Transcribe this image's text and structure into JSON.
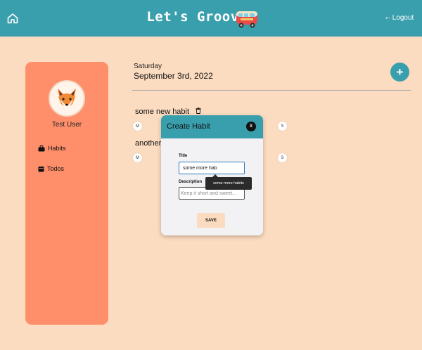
{
  "header": {
    "title": "Let's Groove",
    "logout_label": "Logout",
    "home_icon": "home-icon",
    "logout_icon": "logout-icon",
    "logo_icon": "van-icon",
    "color": "#3a9fad"
  },
  "sidebar": {
    "username": "Test User",
    "avatar_icon": "fox-icon",
    "items": [
      {
        "label": "Habits",
        "icon": "briefcase-icon"
      },
      {
        "label": "Todos",
        "icon": "calendar-icon"
      }
    ],
    "color": "#fe8f6a"
  },
  "main": {
    "day": "Saturday",
    "date": "September 3rd, 2022",
    "add_label": "+",
    "habits": [
      {
        "name": "some new habit",
        "days": [
          "M",
          "S"
        ]
      },
      {
        "name": "another",
        "days": [
          "M",
          "S"
        ]
      }
    ],
    "background": "#fcdcc0"
  },
  "modal": {
    "title": "Create Habit",
    "close_label": "X",
    "title_label": "Title",
    "title_value": "some more hab",
    "autocomplete_suggestion": "some more habits",
    "description_label": "Description",
    "description_placeholder": "Keep it short and sweet...",
    "save_label": "SAVE"
  }
}
